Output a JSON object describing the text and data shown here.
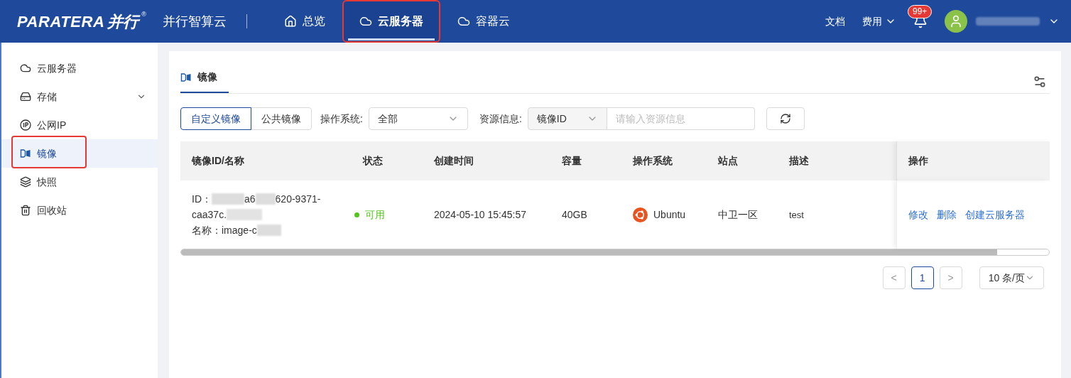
{
  "header": {
    "logo_brand": "PARATERA",
    "logo_cn": "并行",
    "logo_mark": "®",
    "product": "并行智算云",
    "nav": [
      {
        "label": "总览",
        "kind": "home",
        "selected": false,
        "highlighted": false
      },
      {
        "label": "云服务器",
        "kind": "server",
        "selected": true,
        "highlighted": true
      },
      {
        "label": "容器云",
        "kind": "container",
        "selected": false,
        "highlighted": false
      }
    ],
    "docs": "文档",
    "billing": "费用",
    "notification_badge": "99+"
  },
  "sidebar": {
    "items": [
      {
        "label": "云服务器",
        "kind": "server",
        "selected": false,
        "highlighted": false,
        "expandable": false
      },
      {
        "label": "存储",
        "kind": "disk",
        "selected": false,
        "highlighted": false,
        "expandable": true
      },
      {
        "label": "公网IP",
        "kind": "ip",
        "selected": false,
        "highlighted": false,
        "expandable": false
      },
      {
        "label": "镜像",
        "kind": "image",
        "selected": true,
        "highlighted": true,
        "expandable": false
      },
      {
        "label": "快照",
        "kind": "snapshot",
        "selected": false,
        "highlighted": false,
        "expandable": false
      },
      {
        "label": "回收站",
        "kind": "trash",
        "selected": false,
        "highlighted": false,
        "expandable": false
      }
    ]
  },
  "page": {
    "title": "镜像",
    "segments": [
      {
        "label": "自定义镜像",
        "selected": true
      },
      {
        "label": "公共镜像",
        "selected": false
      }
    ],
    "os_filter": {
      "label": "操作系统:",
      "value": "全部"
    },
    "resource_filter": {
      "label": "资源信息:",
      "type": "镜像ID",
      "placeholder": "请输入资源信息"
    },
    "table": {
      "columns": [
        "镜像ID/名称",
        "状态",
        "创建时间",
        "容量",
        "操作系统",
        "站点",
        "描述",
        "操作"
      ],
      "rows": [
        {
          "id_prefix": "ID：",
          "id_part_1": "a6",
          "id_part_2": "620-9371-",
          "id_line_2": "caa37c.",
          "name": "名称：image-c",
          "status": "可用",
          "color": "#52c41a",
          "created": "2024-05-10 15:45:57",
          "capacity": "40GB",
          "os": "Ubuntu",
          "site": "中卫一区",
          "description": "test",
          "actions": [
            "修改",
            "删除",
            "创建云服务器"
          ]
        }
      ]
    },
    "pagination": {
      "prev": "<",
      "pages": [
        {
          "label": "1",
          "selected": true
        }
      ],
      "next": ">",
      "page_size": "10 条/页"
    }
  }
}
